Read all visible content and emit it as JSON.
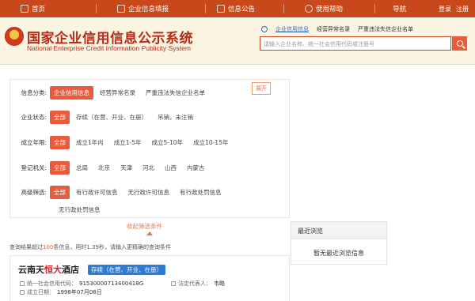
{
  "topnav": {
    "home": "首页",
    "report": "企业信息填报",
    "notice": "信息公告",
    "help": "使用帮助",
    "guide": "导航",
    "login": "登录",
    "register": "注册"
  },
  "header": {
    "title_cn": "国家企业信用信息公示系统",
    "title_en": "National Enterprise Credit Information Publicity System",
    "search_tabs": [
      "企业信用信息",
      "经营异常名录",
      "严重违法失信企业名单"
    ],
    "search_placeholder": "请输入企业名称、统一社会信用代码或注册号"
  },
  "filters": {
    "info_type": {
      "label": "信息分类:",
      "options": [
        "企业信用信息",
        "经营异常名录",
        "严重违法失信企业名单"
      ]
    },
    "status": {
      "label": "企业状态:",
      "options": [
        "全部",
        "存续（在营、开业、在册）",
        "吊销，未注销"
      ]
    },
    "age": {
      "label": "成立年限:",
      "options": [
        "全部",
        "成立1年内",
        "成立1-5年",
        "成立5-10年",
        "成立10-15年"
      ]
    },
    "authority": {
      "label": "登记机关:",
      "options": [
        "全部",
        "总局",
        "北京",
        "天津",
        "河北",
        "山西",
        "内蒙古"
      ],
      "expand": "展开"
    },
    "advanced": {
      "label": "高级筛选:",
      "options": [
        "全部",
        "有行政许可信息",
        "无行政许可信息",
        "有行政处罚信息",
        "无行政处罚信息"
      ]
    },
    "collapse_label": "收起筛选条件"
  },
  "results": {
    "summary_prefix": "查询结果超过",
    "summary_count": "100",
    "summary_suffix": "条信息，用时1.39秒，请输入更精确的查询条件"
  },
  "recent": {
    "title": "最近浏览",
    "empty": "暂无最近浏览信息"
  },
  "card": {
    "name_prefix": "云南天",
    "name_highlight": "恒大",
    "name_suffix": "酒店",
    "status": "存续（在营、开业、在册）",
    "code_label": "统一社会信用代码：",
    "code_value": "91530000713400418G",
    "legal_label": "法定代表人：",
    "legal_value": "韦略",
    "date_label": "成立日期：",
    "date_value": "1998年07月08日"
  },
  "colors": {
    "brand": "#c8481b",
    "accent": "#e85c3c",
    "status_blue": "#2f7bd1"
  }
}
